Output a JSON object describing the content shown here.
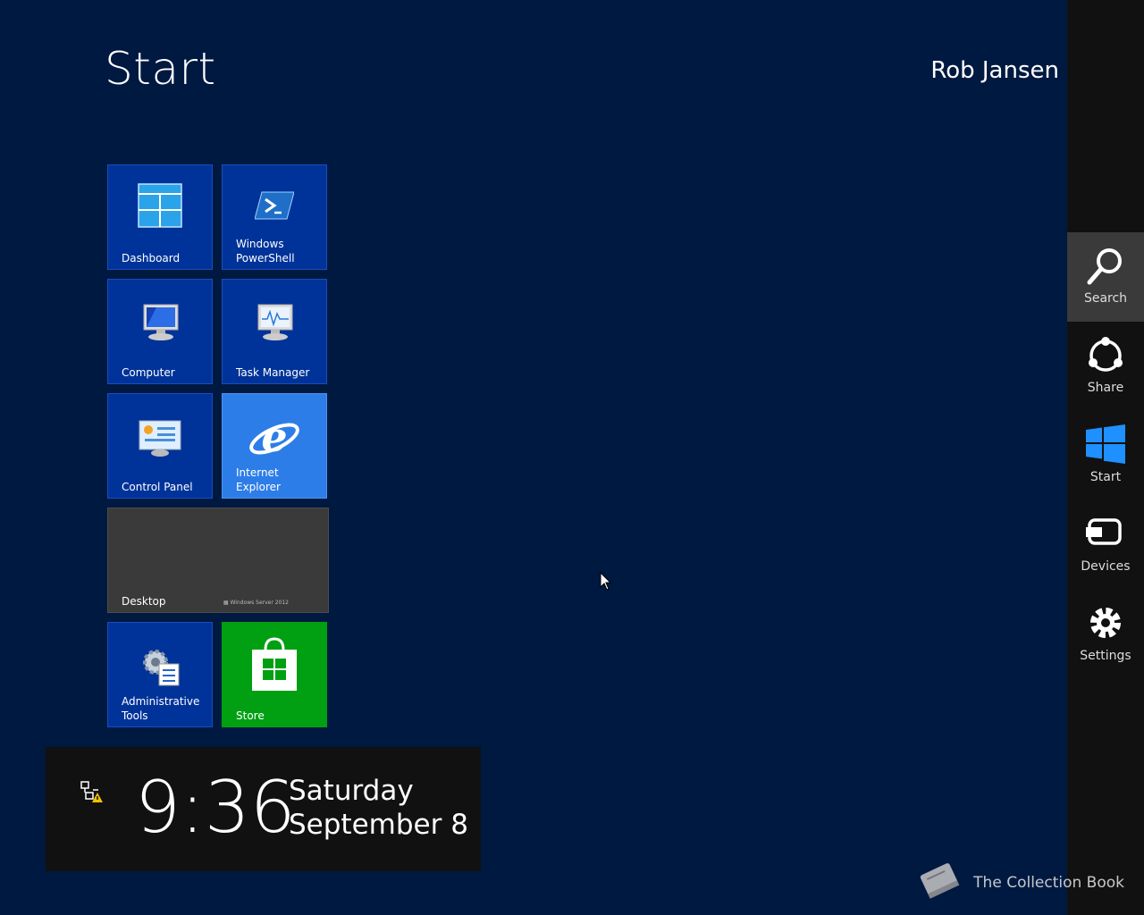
{
  "header": {
    "title": "Start",
    "user": "Rob Jansen"
  },
  "tiles": [
    {
      "label": "Dashboard",
      "icon": "dashboard-icon"
    },
    {
      "label": "Windows PowerShell",
      "icon": "powershell-icon"
    },
    {
      "label": "Computer",
      "icon": "computer-icon"
    },
    {
      "label": "Task Manager",
      "icon": "task-manager-icon"
    },
    {
      "label": "Control Panel",
      "icon": "control-panel-icon"
    },
    {
      "label": "Internet Explorer",
      "icon": "internet-explorer-icon"
    },
    {
      "label": "Desktop",
      "brand": "Windows Server 2012"
    },
    {
      "label": "Administrative Tools",
      "icon": "administrative-tools-icon"
    },
    {
      "label": "Store",
      "icon": "store-icon"
    }
  ],
  "clock": {
    "time": "9:36",
    "day": "Saturday",
    "date": "September 8"
  },
  "charms": [
    {
      "label": "Search",
      "icon": "search-icon"
    },
    {
      "label": "Share",
      "icon": "share-icon"
    },
    {
      "label": "Start",
      "icon": "windows-logo-icon"
    },
    {
      "label": "Devices",
      "icon": "devices-icon"
    },
    {
      "label": "Settings",
      "icon": "gear-icon"
    }
  ],
  "watermark": {
    "text": "The Collection Book",
    "icon": "book-icon"
  },
  "colors": {
    "background": "#001940",
    "tile_blue": "#003399",
    "ie_tile": "#2d7de8",
    "store_tile": "#00a012",
    "desktop_tile": "#3a3a3a",
    "charm_bar": "#111111"
  }
}
